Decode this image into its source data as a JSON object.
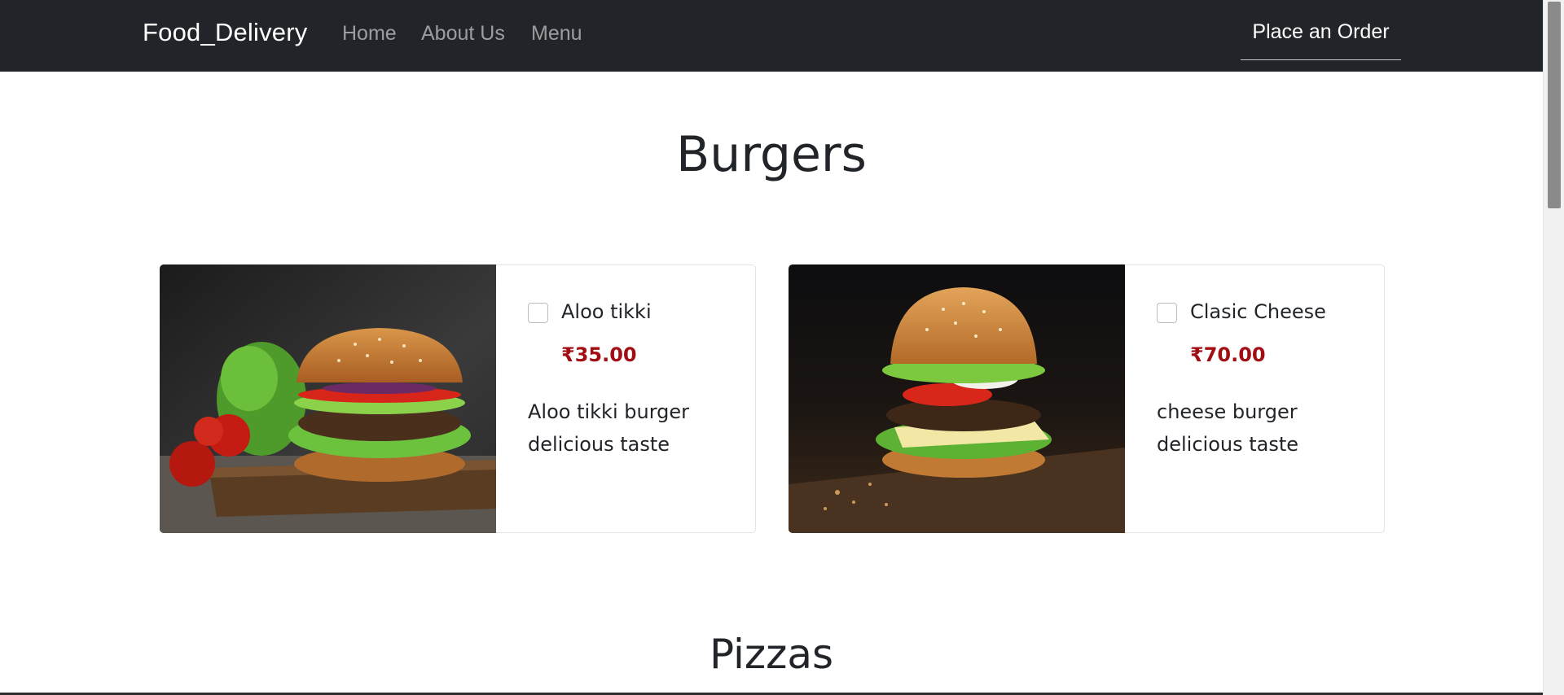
{
  "nav": {
    "brand": "Food_Delivery",
    "links": [
      "Home",
      "About Us",
      "Menu"
    ],
    "order_button": "Place an Order"
  },
  "sections": [
    {
      "title": "Burgers",
      "items": [
        {
          "name": "Aloo tikki",
          "price": "₹35.00",
          "description": "Aloo tikki burger delicious taste",
          "image": "aloo-tikki-burger-photo",
          "checked": false
        },
        {
          "name": "Clasic Cheese",
          "price": "₹70.00",
          "description": "cheese burger delicious taste",
          "image": "cheese-burger-photo",
          "checked": false
        }
      ]
    },
    {
      "title": "Pizzas"
    }
  ],
  "colors": {
    "navbar_bg": "#212529",
    "price": "#a10f14",
    "text": "#212529"
  }
}
